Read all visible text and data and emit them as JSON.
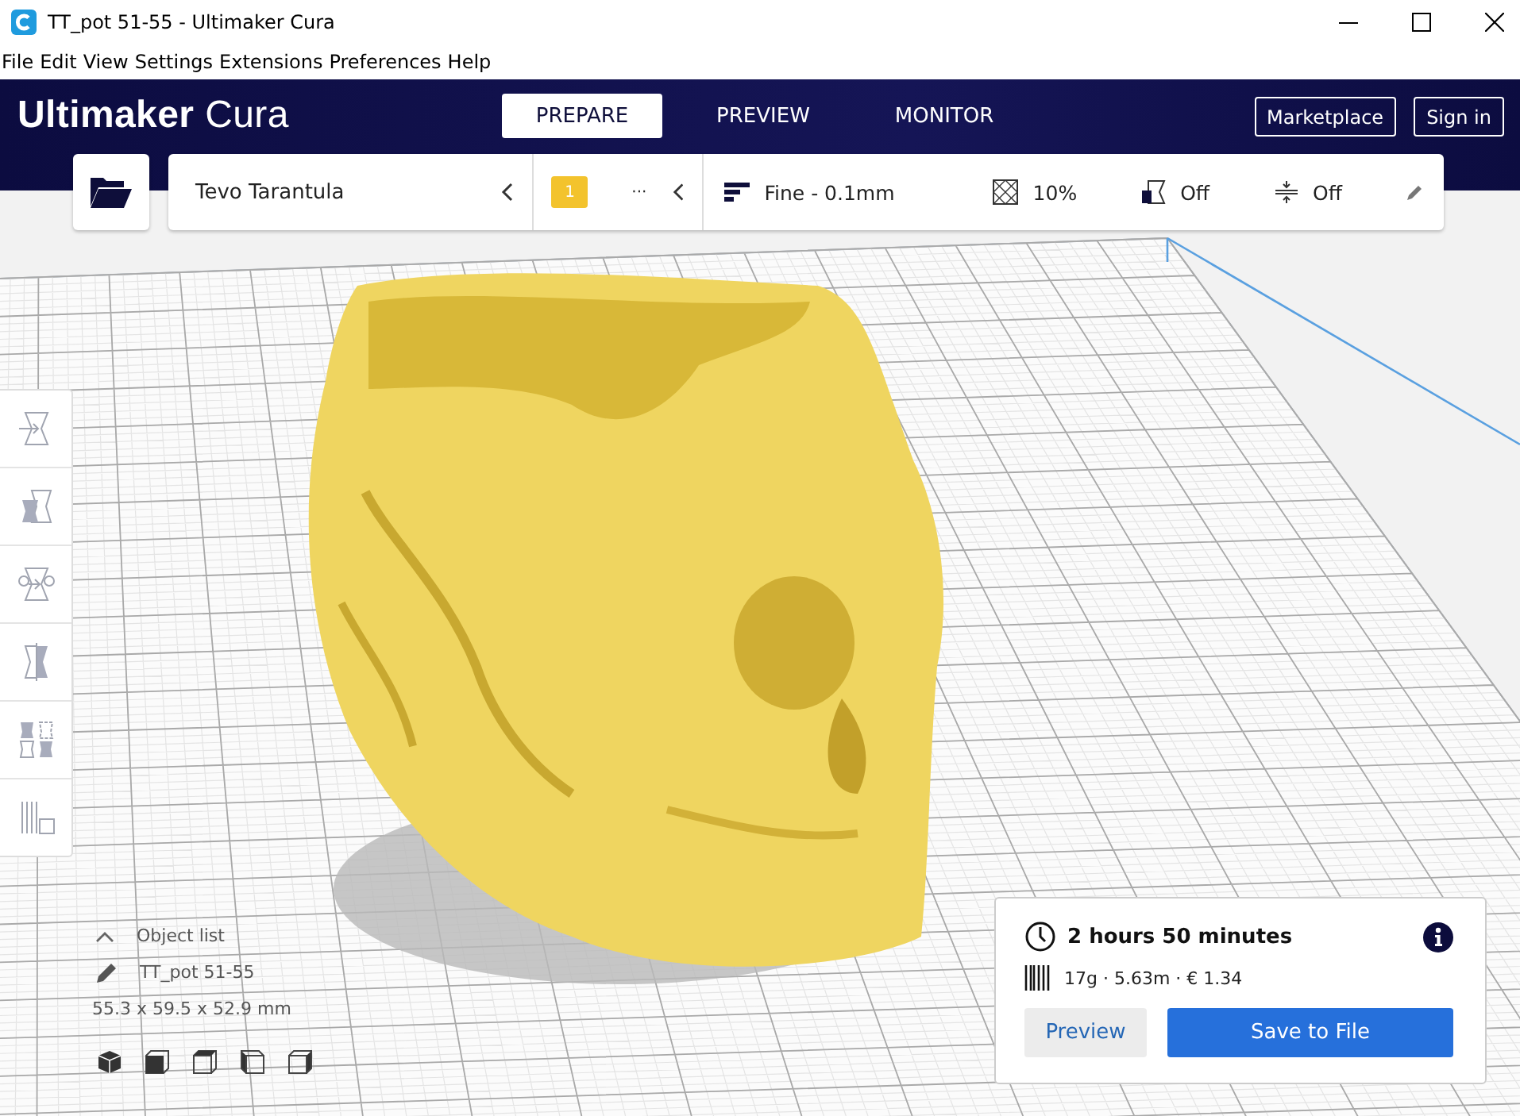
{
  "window": {
    "title": "TT_pot 51-55 - Ultimaker Cura"
  },
  "menu": [
    "File",
    "Edit",
    "View",
    "Settings",
    "Extensions",
    "Preferences",
    "Help"
  ],
  "header": {
    "logo_bold": "Ultimaker",
    "logo_light": "Cura",
    "tabs": [
      {
        "label": "PREPARE",
        "selected": true
      },
      {
        "label": "PREVIEW",
        "selected": false
      },
      {
        "label": "MONITOR",
        "selected": false
      }
    ],
    "buttons": [
      "Marketplace",
      "Sign in"
    ]
  },
  "toolbar": {
    "printer": "Tevo Tarantula",
    "extruder_badge": "1",
    "extruder_more": "···",
    "profile": "Fine - 0.1mm",
    "infill": "10%",
    "support": "Off",
    "adhesion": "Off"
  },
  "object_list": {
    "title": "Object list",
    "object_name": "TT_pot 51-55",
    "dimensions": "55.3 x 59.5 x 52.9 mm"
  },
  "print_panel": {
    "time": "2 hours 50 minutes",
    "material": "17g · 5.63m · € 1.34",
    "buttons": [
      "Preview",
      "Save to File"
    ]
  }
}
